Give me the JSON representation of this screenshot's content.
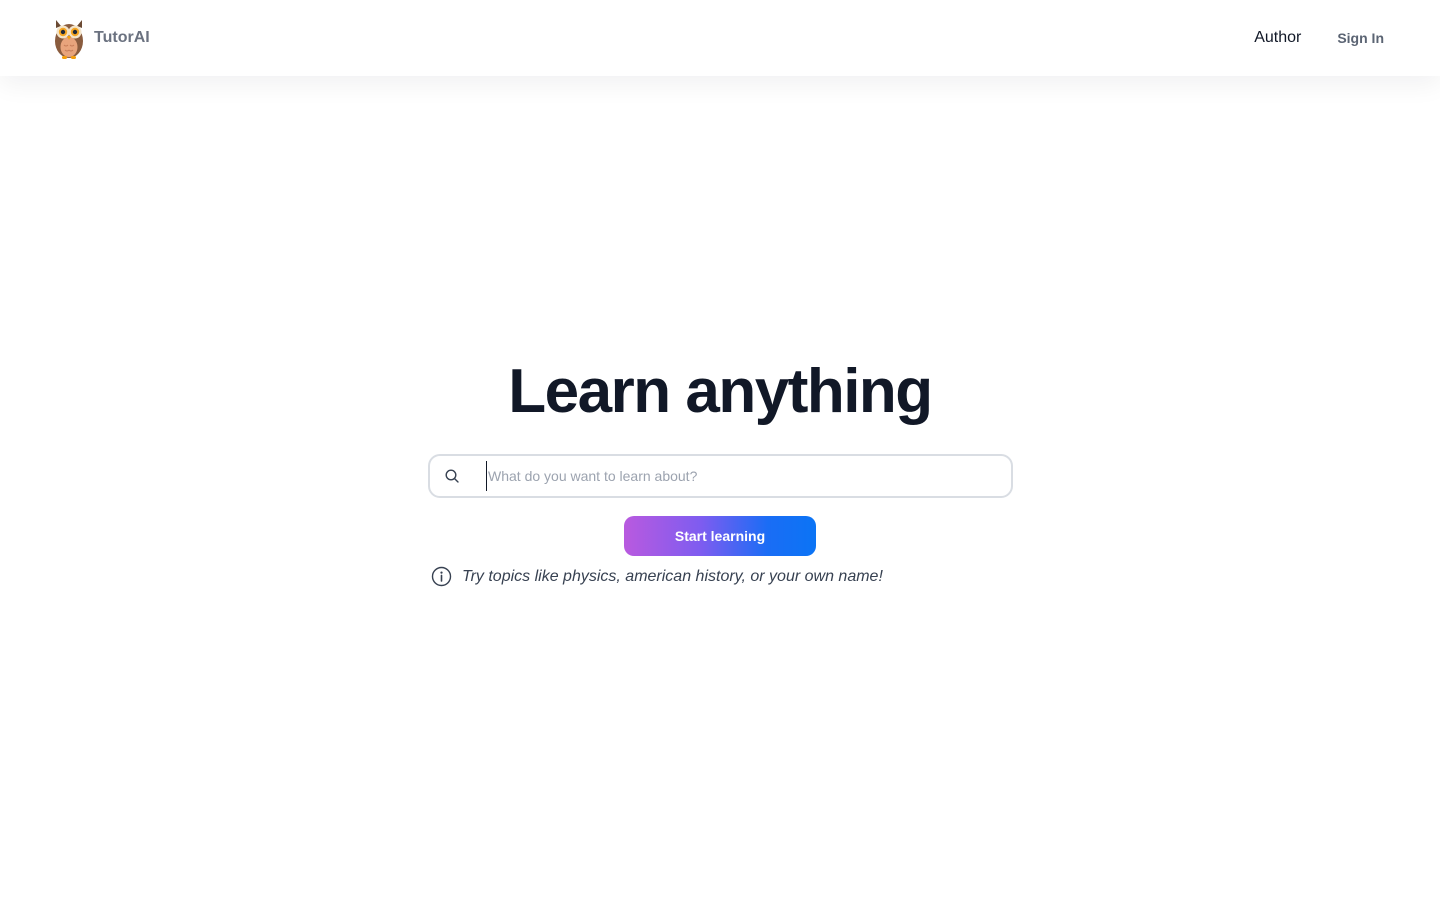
{
  "header": {
    "brand_name": "TutorAI",
    "logo_icon": "owl-icon",
    "nav": {
      "author_label": "Author",
      "signin_label": "Sign In"
    }
  },
  "hero": {
    "title": "Learn anything",
    "search": {
      "icon": "search-icon",
      "placeholder": "What do you want to learn about?",
      "value": ""
    },
    "start_button_label": "Start learning",
    "hint": {
      "icon": "info-icon",
      "text": "Try topics like physics, american history, or your own name!"
    }
  },
  "colors": {
    "title": "#111827",
    "brand_text": "#6b7280",
    "button_gradient_start": "#b95adf",
    "button_gradient_end": "#0b74f5",
    "search_border": "#d9dde3"
  }
}
